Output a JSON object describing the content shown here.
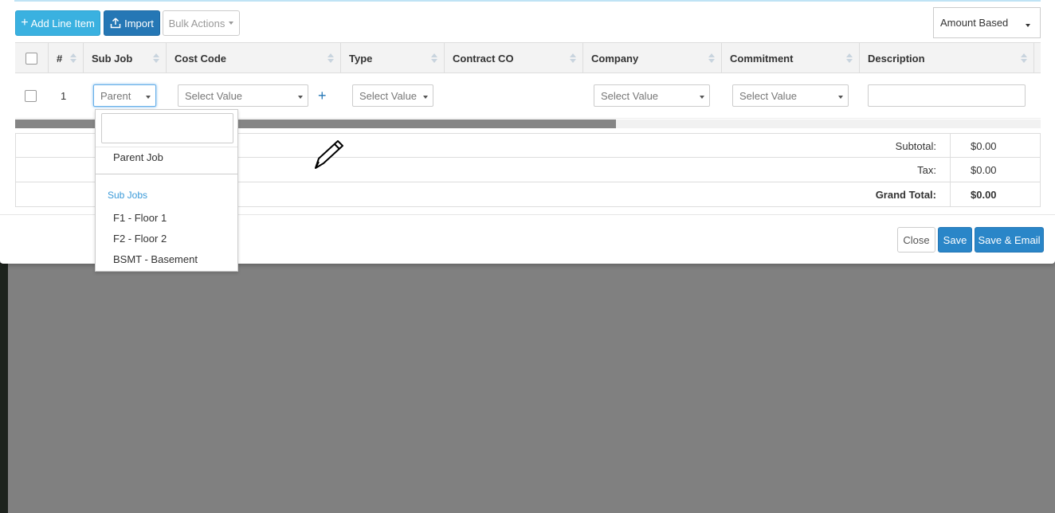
{
  "toolbar": {
    "add_line_item": "Add Line Item",
    "import": "Import",
    "bulk_actions": "Bulk Actions",
    "amount_mode": "Amount Based"
  },
  "table": {
    "columns": [
      "#",
      "Sub Job",
      "Cost Code",
      "Type",
      "Contract CO",
      "Company",
      "Commitment",
      "Description"
    ],
    "row": {
      "number": "1",
      "sub_job": "Parent",
      "cost_code": "Select Value",
      "type": "Select Value",
      "company": "Select Value",
      "commitment": "Select Value",
      "add_cost_code": "+"
    }
  },
  "totals": {
    "subtotal_label": "Subtotal:",
    "subtotal_value": "$0.00",
    "tax_label": "Tax:",
    "tax_value": "$0.00",
    "grand_total_label": "Grand Total:",
    "grand_total_value": "$0.00"
  },
  "footer": {
    "close": "Close",
    "save": "Save",
    "save_email": "Save & Email"
  },
  "subjob_dropdown": {
    "parent_option": "Parent Job",
    "group_label": "Sub Jobs",
    "options": [
      "F1 - Floor 1",
      "F2 - Floor 2",
      "BSMT - Basement"
    ]
  },
  "colors": {
    "add_button": "#3ab1e0",
    "primary_button": "#2a86c8",
    "overlay": "#808080",
    "link": "#3a9ad9"
  }
}
